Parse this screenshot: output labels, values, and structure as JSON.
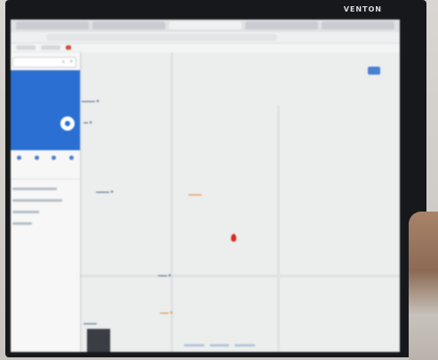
{
  "brand": "VENTON",
  "panel": {
    "search_value": "",
    "place_name": "",
    "directions_label": "",
    "actions": [
      "",
      "",
      "",
      ""
    ]
  },
  "colors": {
    "panel_blue": "#2a6fd1",
    "pin_red": "#d82a1e",
    "map_bg": "#eceeed"
  }
}
